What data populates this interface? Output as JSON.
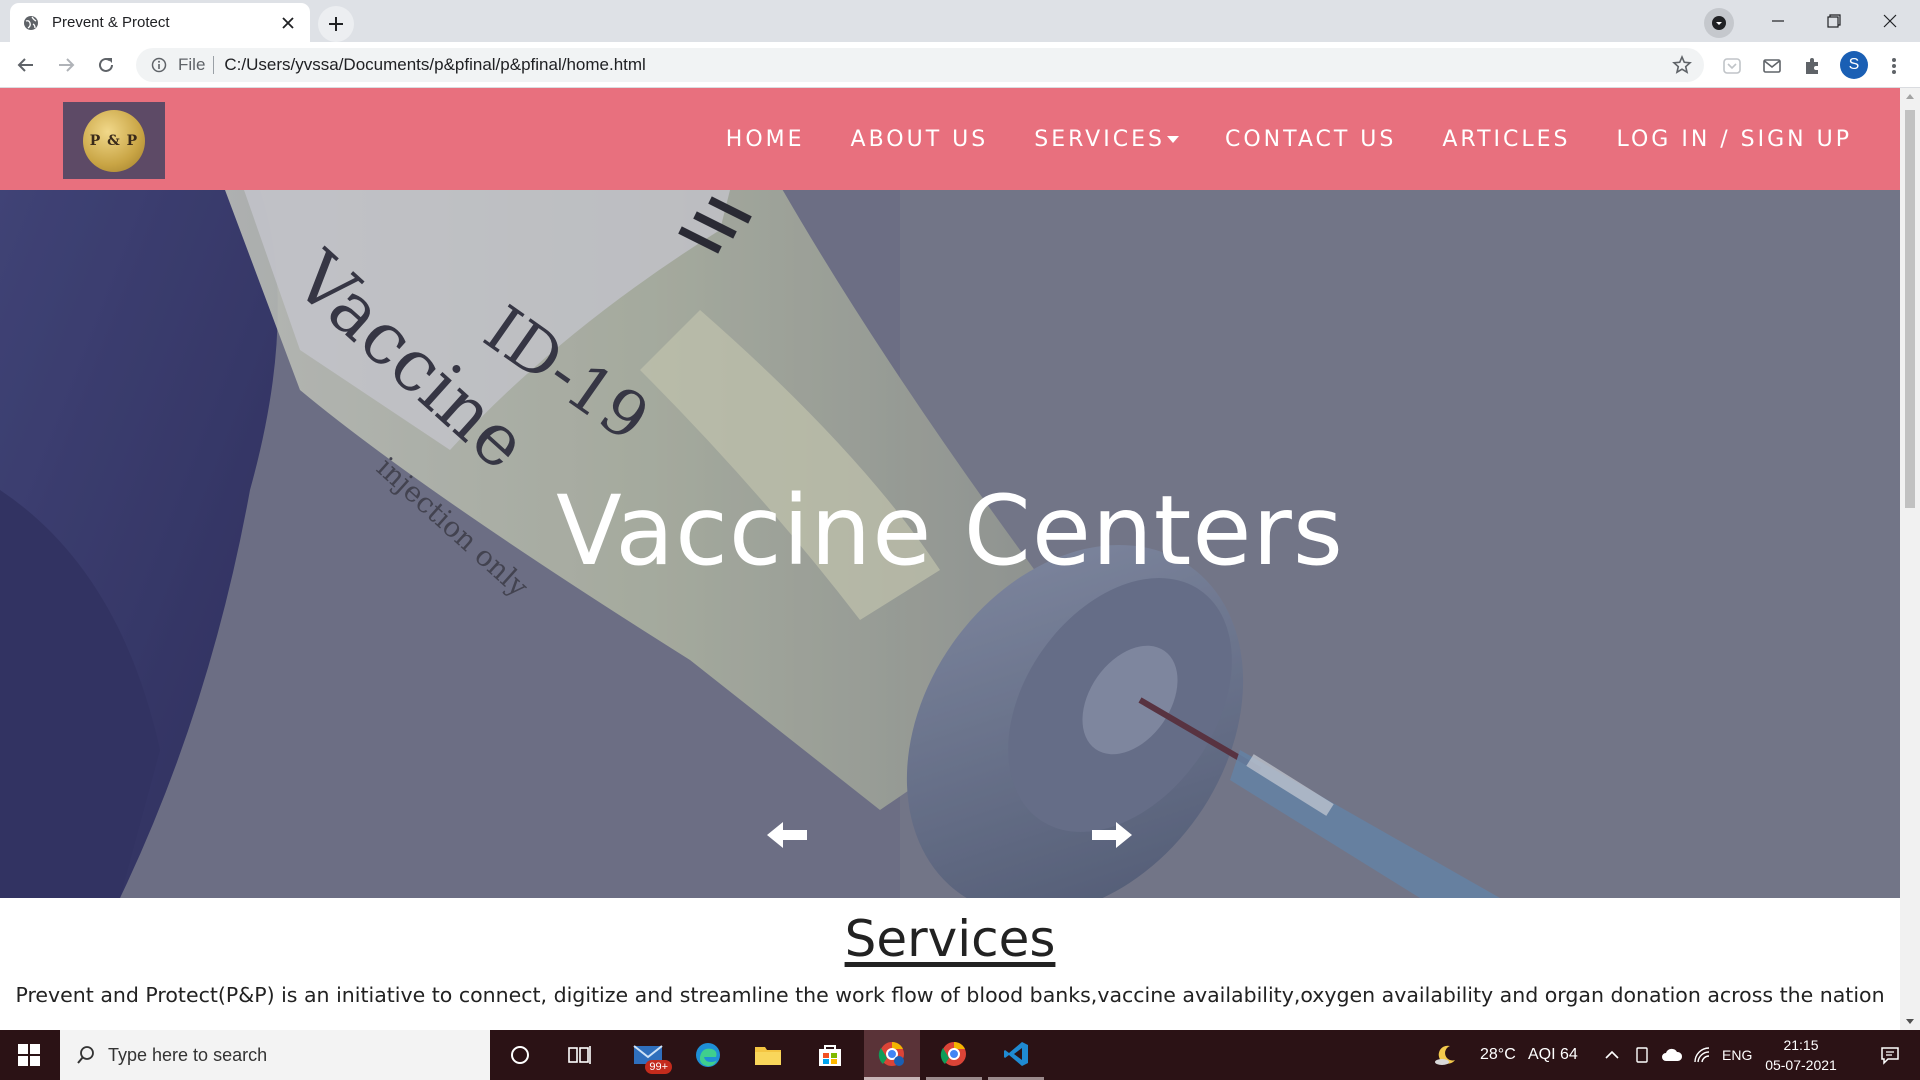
{
  "browser": {
    "tab_title": "Prevent & Protect",
    "scheme_label": "File",
    "url": "C:/Users/yvssa/Documents/p&pfinal/p&pfinal/home.html",
    "profile_initial": "S"
  },
  "site": {
    "logo_text": "P & P",
    "nav": {
      "home": "HOME",
      "about": "ABOUT US",
      "services": "SERVICES",
      "contact": "CONTACT US",
      "articles": "ARTICLES",
      "login": "LOG IN / SIGN UP"
    },
    "hero": {
      "heading": "Vaccine Centers",
      "vial_label_1": "ID-19",
      "vial_label_2": "Vaccine",
      "vial_label_3": "injection only"
    },
    "services": {
      "heading": "Services",
      "description": "Prevent and Protect(P&P) is an initiative to connect, digitize and streamline the work flow of blood banks,vaccine availability,oxygen availability and organ donation across the nation"
    }
  },
  "taskbar": {
    "search_placeholder": "Type here to search",
    "mail_badge": "99+",
    "weather": "28°C",
    "aqi": "AQI 64",
    "language": "ENG",
    "time": "21:15",
    "date": "05-07-2021"
  },
  "colors": {
    "nav_bg": "#e8707e",
    "taskbar_bg": "#2b1215"
  }
}
